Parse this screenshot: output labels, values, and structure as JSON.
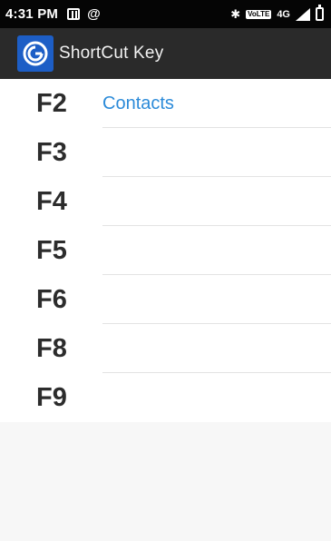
{
  "status_bar": {
    "time": "4:31 PM",
    "icons_left": [
      "sim-card-icon",
      "at-sign-icon"
    ],
    "icons_right": [
      "bluetooth-icon",
      "volte-icon",
      "4g-icon",
      "signal-icon",
      "battery-icon"
    ],
    "volte_label": "VoLTE",
    "network_label": "4G",
    "at_glyph": "@",
    "bt_glyph": "✱"
  },
  "app_bar": {
    "title": "ShortCut Key",
    "logo_icon": "shortcut-key-app-icon",
    "bg_color": "#2a2a2a"
  },
  "key_list": {
    "items": [
      {
        "key": "F2",
        "action": "Contacts"
      },
      {
        "key": "F3",
        "action": ""
      },
      {
        "key": "F4",
        "action": ""
      },
      {
        "key": "F5",
        "action": ""
      },
      {
        "key": "F6",
        "action": ""
      },
      {
        "key": "F8",
        "action": ""
      },
      {
        "key": "F9",
        "action": ""
      }
    ],
    "accent_color": "#2c8bd9"
  }
}
